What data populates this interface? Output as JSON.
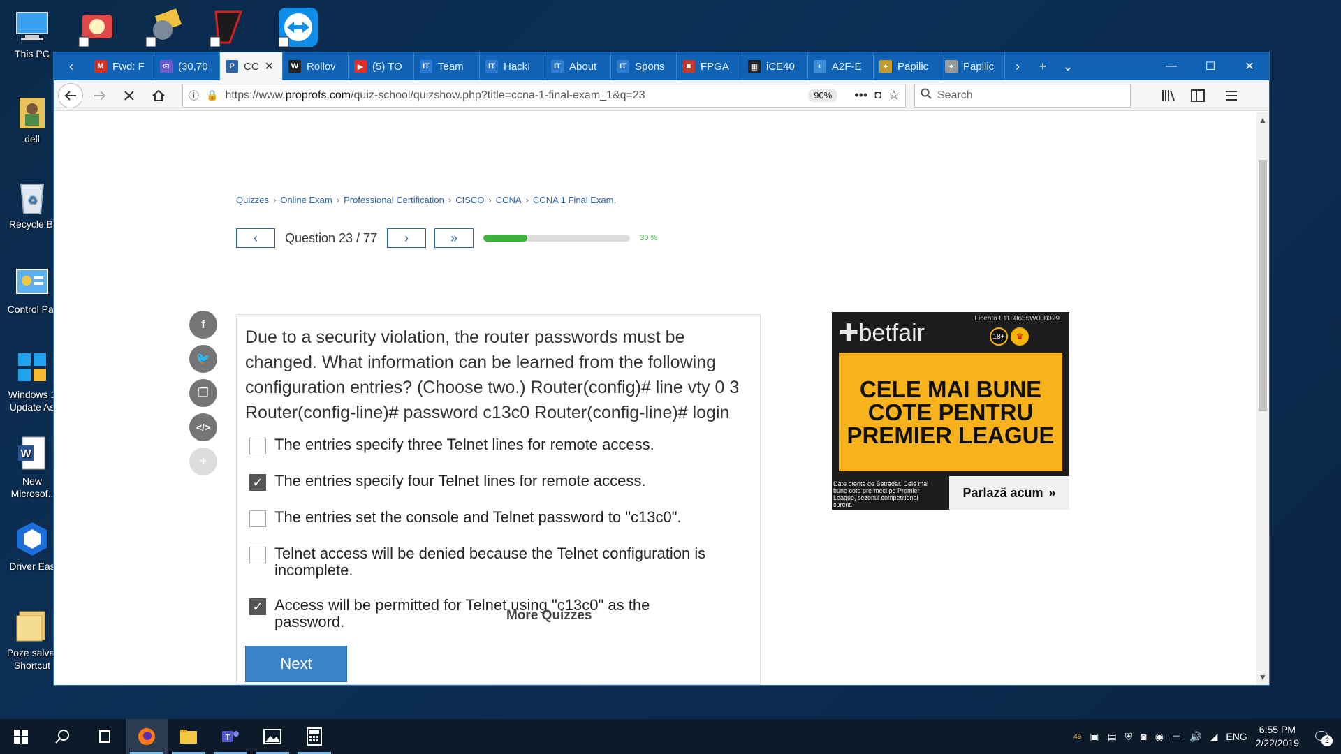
{
  "desktop": {
    "icons": [
      {
        "label": "This PC"
      },
      {
        "label": "dell"
      },
      {
        "label": "Recycle Bi"
      },
      {
        "label": "Control Par"
      },
      {
        "label": "Windows 1\nUpdate As"
      },
      {
        "label": "New\nMicrosof.."
      },
      {
        "label": "Driver Eas"
      },
      {
        "label": "Poze salvat\nShortcut"
      }
    ]
  },
  "browser": {
    "tabs": [
      {
        "label": "Fwd: F",
        "color": "#d93025",
        "glyph": "M"
      },
      {
        "label": "(30,70",
        "color": "#6a5acd",
        "glyph": "✉"
      },
      {
        "label": "CC",
        "color": "#2c64a8",
        "glyph": "P",
        "active": true
      },
      {
        "label": "Rollov",
        "color": "#222222",
        "glyph": "W"
      },
      {
        "label": "(5) TO",
        "color": "#e52d27",
        "glyph": "▶"
      },
      {
        "label": "Team",
        "color": "#2b7bd6",
        "glyph": "IT"
      },
      {
        "label": "HackI",
        "color": "#2b7bd6",
        "glyph": "IT"
      },
      {
        "label": "About",
        "color": "#2b7bd6",
        "glyph": "IT"
      },
      {
        "label": "Spons",
        "color": "#2b7bd6",
        "glyph": "IT"
      },
      {
        "label": "FPGA",
        "color": "#c0392b",
        "glyph": "■"
      },
      {
        "label": "iCE40",
        "color": "#222222",
        "glyph": "▦"
      },
      {
        "label": "A2F-E",
        "color": "#3a8ed8",
        "glyph": "◐"
      },
      {
        "label": "Papilic",
        "color": "#c49b2a",
        "glyph": "✦"
      },
      {
        "label": "Papilic",
        "color": "#999999",
        "glyph": "✦"
      }
    ],
    "url_prefix": "https://www.",
    "url_domain": "proprofs.com",
    "url_path": "/quiz-school/quizshow.php?title=ccna-1-final-exam_1&q=23",
    "zoom": "90%",
    "search_placeholder": "Search"
  },
  "page": {
    "breadcrumb": [
      "Quizzes",
      "Online Exam",
      "Professional Certification",
      "CISCO",
      "CCNA",
      "CCNA 1 Final Exam."
    ],
    "question_counter": "Question 23 / 77",
    "progress_percent": 30,
    "progress_label": "30 %",
    "question": "Due to a security violation, the router passwords must be changed. What information can be learned from the  following configuration entries? (Choose two.) Router(config)# line vty 0 3 Router(config-line)# password c13c0 Router(config-line)# login",
    "options": [
      {
        "text": "The entries specify three Telnet lines for remote access.",
        "checked": false
      },
      {
        "text": "The entries specify four Telnet lines for remote access.",
        "checked": true
      },
      {
        "text": "The entries set the console and Telnet password to \"c13c0\".",
        "checked": false
      },
      {
        "text": "Telnet access will be denied because the Telnet configuration is incomplete.",
        "checked": false
      },
      {
        "text": "Access will be permitted for Telnet using \"c13c0\" as the password.",
        "checked": true
      }
    ],
    "next_label": "Next",
    "more_quizzes": "More Quizzes",
    "ad": {
      "logo": "betfair",
      "license": "Licenta L1160655W000329",
      "age": "18+",
      "headline": "CELE MAI BUNE COTE PENTRU PREMIER LEAGUE",
      "small_print": "Date oferite de Betradar. Cele mai bune cote pre-meci pe Premier League, sezonul competiţional curent.",
      "cta": "Parlază acum"
    }
  },
  "taskbar": {
    "tray_temp": "46",
    "language": "ENG",
    "time": "6:55 PM",
    "date": "2/22/2019",
    "notifications": "2"
  }
}
